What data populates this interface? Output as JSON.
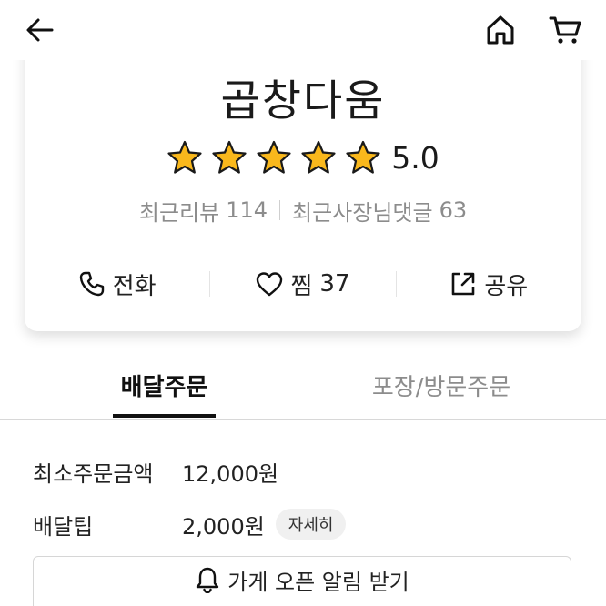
{
  "store": {
    "name": "곱창다움",
    "rating": 5.0,
    "rating_text": "5.0",
    "stars_filled": 5,
    "stars_total": 5,
    "star_color": "#F9B81C",
    "recent_reviews_label": "최근리뷰",
    "recent_reviews_count": "114",
    "owner_replies_label": "최근사장님댓글",
    "owner_replies_count": "63"
  },
  "actions": {
    "call_label": "전화",
    "wish_label": "찜",
    "wish_count": "37",
    "share_label": "공유"
  },
  "tabs": [
    {
      "label": "배달주문",
      "active": true
    },
    {
      "label": "포장/방문주문",
      "active": false
    }
  ],
  "info": {
    "min_order_label": "최소주문금액",
    "min_order_value": "12,000원",
    "delivery_tip_label": "배달팁",
    "delivery_tip_value": "2,000원",
    "detail_chip": "자세히"
  },
  "notify_button_label": "가게 오픈 알림 받기",
  "icons": {
    "back": "back-arrow-icon",
    "home": "home-icon",
    "cart": "cart-icon",
    "star": "star-icon",
    "phone": "phone-icon",
    "heart": "heart-icon",
    "share": "share-icon",
    "bell": "bell-icon"
  }
}
